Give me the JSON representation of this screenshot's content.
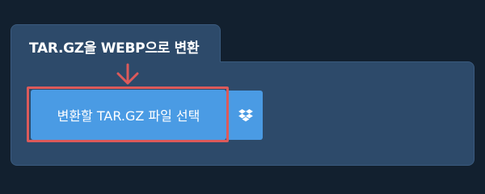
{
  "tab": {
    "title": "TAR.GZ을 WEBP으로 변환"
  },
  "upload": {
    "select_file_label": "변환할 TAR.GZ 파일 선택"
  },
  "icons": {
    "arrow": "arrow-down-icon",
    "dropbox": "dropbox-icon"
  },
  "colors": {
    "background": "#12202f",
    "panel": "#2d4a6a",
    "button": "#4a9be4",
    "highlight": "#dc5a5a"
  }
}
